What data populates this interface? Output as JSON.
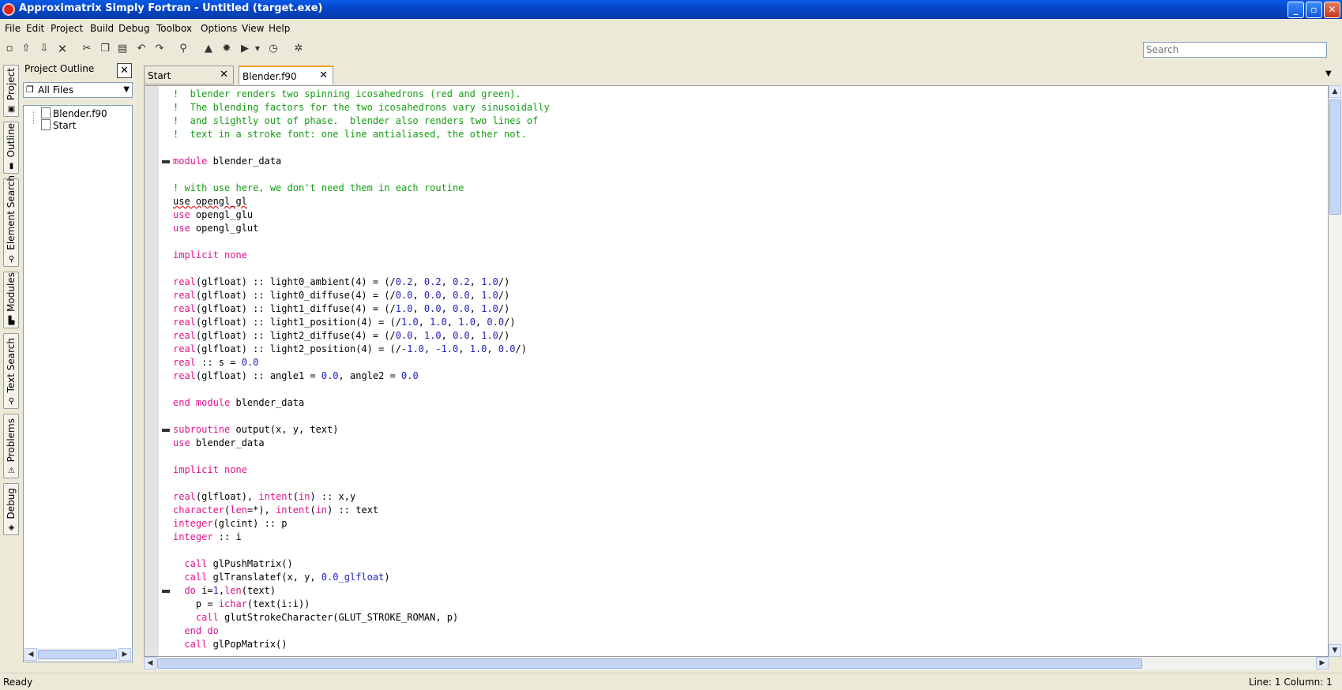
{
  "window": {
    "title": "Approximatrix Simply Fortran - Untitled (target.exe)",
    "controls": {
      "minimize": "_",
      "maximize": "▫",
      "close": "✕"
    }
  },
  "menu": [
    "File",
    "Edit",
    "Project",
    "Build",
    "Debug",
    "Toolbox",
    "Options",
    "View",
    "Help"
  ],
  "toolbar": {
    "icons": [
      "new-file-icon",
      "open-icon",
      "save-icon",
      "close-icon",
      "cut-icon",
      "copy-icon",
      "paste-icon",
      "undo-icon",
      "redo-icon",
      "find-icon",
      "build-icon",
      "settings-icon",
      "run-icon",
      "run-dropdown-icon",
      "stop-icon",
      "debug-icon"
    ],
    "search_placeholder": "Search"
  },
  "side_tabs": [
    "Project",
    "Outline",
    "Element Search",
    "Modules",
    "Text Search",
    "Problems",
    "Debug"
  ],
  "outline": {
    "header": "Project Outline",
    "filter": "All Files",
    "files": [
      "Blender.f90",
      "Start"
    ]
  },
  "tabs": [
    {
      "label": "Start",
      "active": false
    },
    {
      "label": "Blender.f90",
      "active": true
    }
  ],
  "code": [
    [
      [
        "cmt",
        "!  blender renders two spinning icosahedrons (red and green)."
      ]
    ],
    [
      [
        "cmt",
        "!  The blending factors for the two icosahedrons vary sinusoidally"
      ]
    ],
    [
      [
        "cmt",
        "!  and slightly out of phase.  blender also renders two lines of"
      ]
    ],
    [
      [
        "cmt",
        "!  text in a stroke font: one line antialiased, the other not."
      ]
    ],
    [],
    [
      [
        "kw",
        "module"
      ],
      [
        "",
        " blender_data"
      ]
    ],
    [],
    [
      [
        "cmt",
        "! with use here, we don't need them in each routine"
      ]
    ],
    [
      [
        "sq",
        "use opengl_gl"
      ]
    ],
    [
      [
        "kw",
        "use"
      ],
      [
        "",
        " opengl_glu"
      ]
    ],
    [
      [
        "kw",
        "use"
      ],
      [
        "",
        " opengl_glut"
      ]
    ],
    [],
    [
      [
        "kw",
        "implicit none"
      ]
    ],
    [],
    [
      [
        "kw",
        "real"
      ],
      [
        "",
        "(glfloat) :: light0_ambient(4) = (/"
      ],
      [
        "num",
        "0.2"
      ],
      [
        "",
        ", "
      ],
      [
        "num",
        "0.2"
      ],
      [
        "",
        ", "
      ],
      [
        "num",
        "0.2"
      ],
      [
        "",
        ", "
      ],
      [
        "num",
        "1.0"
      ],
      [
        "",
        "/)"
      ]
    ],
    [
      [
        "kw",
        "real"
      ],
      [
        "",
        "(glfloat) :: light0_diffuse(4) = (/"
      ],
      [
        "num",
        "0.0"
      ],
      [
        "",
        ", "
      ],
      [
        "num",
        "0.0"
      ],
      [
        "",
        ", "
      ],
      [
        "num",
        "0.0"
      ],
      [
        "",
        ", "
      ],
      [
        "num",
        "1.0"
      ],
      [
        "",
        "/)"
      ]
    ],
    [
      [
        "kw",
        "real"
      ],
      [
        "",
        "(glfloat) :: light1_diffuse(4) = (/"
      ],
      [
        "num",
        "1.0"
      ],
      [
        "",
        ", "
      ],
      [
        "num",
        "0.0"
      ],
      [
        "",
        ", "
      ],
      [
        "num",
        "0.0"
      ],
      [
        "",
        ", "
      ],
      [
        "num",
        "1.0"
      ],
      [
        "",
        "/)"
      ]
    ],
    [
      [
        "kw",
        "real"
      ],
      [
        "",
        "(glfloat) :: light1_position(4) = (/"
      ],
      [
        "num",
        "1.0"
      ],
      [
        "",
        ", "
      ],
      [
        "num",
        "1.0"
      ],
      [
        "",
        ", "
      ],
      [
        "num",
        "1.0"
      ],
      [
        "",
        ", "
      ],
      [
        "num",
        "0.0"
      ],
      [
        "",
        "/)"
      ]
    ],
    [
      [
        "kw",
        "real"
      ],
      [
        "",
        "(glfloat) :: light2_diffuse(4) = (/"
      ],
      [
        "num",
        "0.0"
      ],
      [
        "",
        ", "
      ],
      [
        "num",
        "1.0"
      ],
      [
        "",
        ", "
      ],
      [
        "num",
        "0.0"
      ],
      [
        "",
        ", "
      ],
      [
        "num",
        "1.0"
      ],
      [
        "",
        "/)"
      ]
    ],
    [
      [
        "kw",
        "real"
      ],
      [
        "",
        "(glfloat) :: light2_position(4) = (/"
      ],
      [
        "num",
        "-1.0"
      ],
      [
        "",
        ", "
      ],
      [
        "num",
        "-1.0"
      ],
      [
        "",
        ", "
      ],
      [
        "num",
        "1.0"
      ],
      [
        "",
        ", "
      ],
      [
        "num",
        "0.0"
      ],
      [
        "",
        "/)"
      ]
    ],
    [
      [
        "kw",
        "real"
      ],
      [
        "",
        " :: s = "
      ],
      [
        "num",
        "0.0"
      ]
    ],
    [
      [
        "kw",
        "real"
      ],
      [
        "",
        "(glfloat) :: angle1 = "
      ],
      [
        "num",
        "0.0"
      ],
      [
        "",
        ", angle2 = "
      ],
      [
        "num",
        "0.0"
      ]
    ],
    [],
    [
      [
        "kw",
        "end module"
      ],
      [
        "",
        " blender_data"
      ]
    ],
    [],
    [
      [
        "kw",
        "subroutine"
      ],
      [
        "",
        " output(x, y, text)"
      ]
    ],
    [
      [
        "kw",
        "use"
      ],
      [
        "",
        " blender_data"
      ]
    ],
    [],
    [
      [
        "kw",
        "implicit none"
      ]
    ],
    [],
    [
      [
        "kw",
        "real"
      ],
      [
        "",
        "(glfloat), "
      ],
      [
        "kw",
        "intent"
      ],
      [
        "",
        "("
      ],
      [
        "kw",
        "in"
      ],
      [
        "",
        ") :: x,y"
      ]
    ],
    [
      [
        "kw",
        "character"
      ],
      [
        "",
        "("
      ],
      [
        "kw",
        "len"
      ],
      [
        "",
        "=*), "
      ],
      [
        "kw",
        "intent"
      ],
      [
        "",
        "("
      ],
      [
        "kw",
        "in"
      ],
      [
        "",
        ") :: text"
      ]
    ],
    [
      [
        "kw",
        "integer"
      ],
      [
        "",
        "(glcint) :: p"
      ]
    ],
    [
      [
        "kw",
        "integer"
      ],
      [
        "",
        " :: i"
      ]
    ],
    [],
    [
      [
        "",
        "  "
      ],
      [
        "kw",
        "call"
      ],
      [
        "",
        " glPushMatrix()"
      ]
    ],
    [
      [
        "",
        "  "
      ],
      [
        "kw",
        "call"
      ],
      [
        "",
        " glTranslatef(x, y, "
      ],
      [
        "num",
        "0.0_glfloat"
      ],
      [
        "",
        ")"
      ]
    ],
    [
      [
        "",
        "  "
      ],
      [
        "kw",
        "do"
      ],
      [
        "",
        " i="
      ],
      [
        "num",
        "1"
      ],
      [
        "",
        ","
      ],
      [
        "kw",
        "len"
      ],
      [
        "",
        "(text)"
      ]
    ],
    [
      [
        "",
        "    p = "
      ],
      [
        "kw",
        "ichar"
      ],
      [
        "",
        "(text(i:i))"
      ]
    ],
    [
      [
        "",
        "    "
      ],
      [
        "kw",
        "call"
      ],
      [
        "",
        " glutStrokeCharacter(GLUT_STROKE_ROMAN, p)"
      ]
    ],
    [
      [
        "",
        "  "
      ],
      [
        "kw",
        "end do"
      ]
    ],
    [
      [
        "",
        "  "
      ],
      [
        "kw",
        "call"
      ],
      [
        "",
        " glPopMatrix()"
      ]
    ]
  ],
  "fold_lines": [
    5,
    25,
    37
  ],
  "status": {
    "ready": "Ready",
    "position": "Line: 1 Column: 1"
  }
}
